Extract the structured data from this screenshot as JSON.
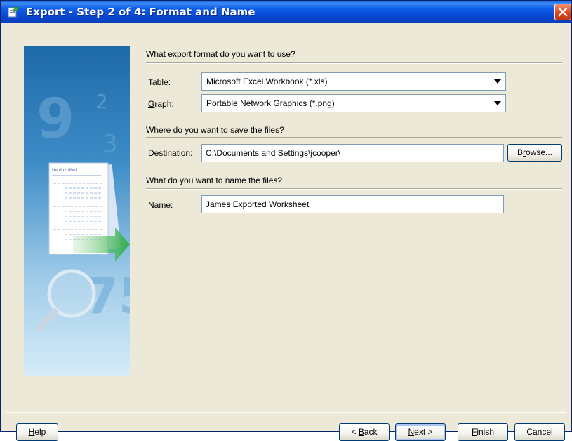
{
  "window": {
    "title": "Export - Step 2 of 4: Format and Name"
  },
  "format_section": {
    "heading": "What export format do you want to use?",
    "table_label_u": "T",
    "table_label_rest": "able:",
    "table_value": "Microsoft Excel Workbook (*.xls)",
    "graph_label_u": "G",
    "graph_label_rest": "raph:",
    "graph_value": "Portable Network Graphics (*.png)"
  },
  "save_section": {
    "heading": "Where do you want to save the files?",
    "destination_label": "Destination:",
    "destination_value": "C:\\Documents and Settings\\jcooper\\",
    "browse_pre": "B",
    "browse_u": "r",
    "browse_post": "owse..."
  },
  "name_section": {
    "heading": "What do you want to name the files?",
    "name_label_pre": "Na",
    "name_label_u": "m",
    "name_label_post": "e:",
    "name_value": "James Exported Worksheet"
  },
  "buttons": {
    "help_u": "H",
    "help_rest": "elp",
    "back_pre": "< ",
    "back_u": "B",
    "back_post": "ack",
    "next_u": "N",
    "next_post": "ext >",
    "finish_u": "F",
    "finish_post": "inish",
    "cancel": "Cancel"
  },
  "colors": {
    "titlebar": "#0a58e8",
    "dialog_bg": "#ece9d8",
    "close_button": "#d8431c"
  },
  "icons": {
    "window_icon": "export-wizard-icon",
    "close": "close-icon",
    "dropdown": "dropdown-arrow-icon",
    "illustration": "document-magnifier-illustration"
  }
}
